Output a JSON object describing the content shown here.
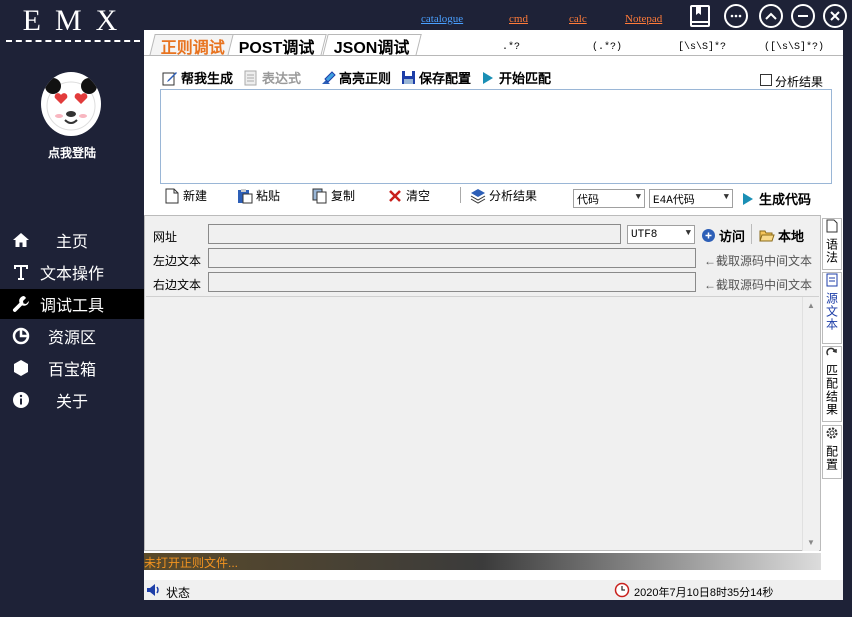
{
  "app": {
    "logo": "EMX"
  },
  "user": {
    "login_label": "点我登陆"
  },
  "nav": [
    {
      "label": "主页",
      "icon": "home-icon"
    },
    {
      "label": "文本操作",
      "icon": "text-icon"
    },
    {
      "label": "调试工具",
      "icon": "wrench-icon",
      "active": true
    },
    {
      "label": "资源区",
      "icon": "pie-chart-icon"
    },
    {
      "label": "百宝箱",
      "icon": "hexagon-icon"
    },
    {
      "label": "关于",
      "icon": "info-icon"
    }
  ],
  "header": {
    "links": [
      "catalogue",
      "cmd",
      "calc",
      "Notepad"
    ],
    "link_colors": {
      "catalogue": "#4aa0ff",
      "cmd": "#ff7b3a",
      "calc": "#ff7b3a",
      "Notepad": "#ff7b3a"
    }
  },
  "tabs": [
    "正则调试",
    "POST调试",
    "JSON调试"
  ],
  "hint_patterns": [
    ".*?",
    "(.*?)",
    "[\\s\\S]*?",
    "([\\s\\S]*?)"
  ],
  "toolbar": {
    "help_generate": "帮我生成",
    "expression": "表达式",
    "highlight_regex": "高亮正则",
    "save_config": "保存配置",
    "start_match": "开始匹配",
    "analyze_results_checkbox": "分析结果"
  },
  "toolbar2": {
    "new": "新建",
    "paste": "粘贴",
    "copy": "复制",
    "clear": "清空",
    "analyze_results": "分析结果",
    "code_select": "代码",
    "code_type_select": "E4A代码",
    "generate_code": "生成代码"
  },
  "source": {
    "url_label": "网址",
    "encoding": "UTF8",
    "visit": "访问",
    "local": "本地",
    "left_text_label": "左边文本",
    "right_text_label": "右边文本",
    "left_hint": "←截取源码中间文本",
    "right_hint": "←截取源码中间文本"
  },
  "side_tabs": [
    "语法",
    "源文本",
    "匹配结果",
    "配置"
  ],
  "status": {
    "no_file": "未打开正则文件...",
    "state_label": "状态",
    "datetime": "2020年7月10日8时35分14秒"
  },
  "colors": {
    "sidebar_bg": "#1e2237",
    "active_tab": "#e8731f",
    "accent_blue": "#1d3ea8"
  }
}
